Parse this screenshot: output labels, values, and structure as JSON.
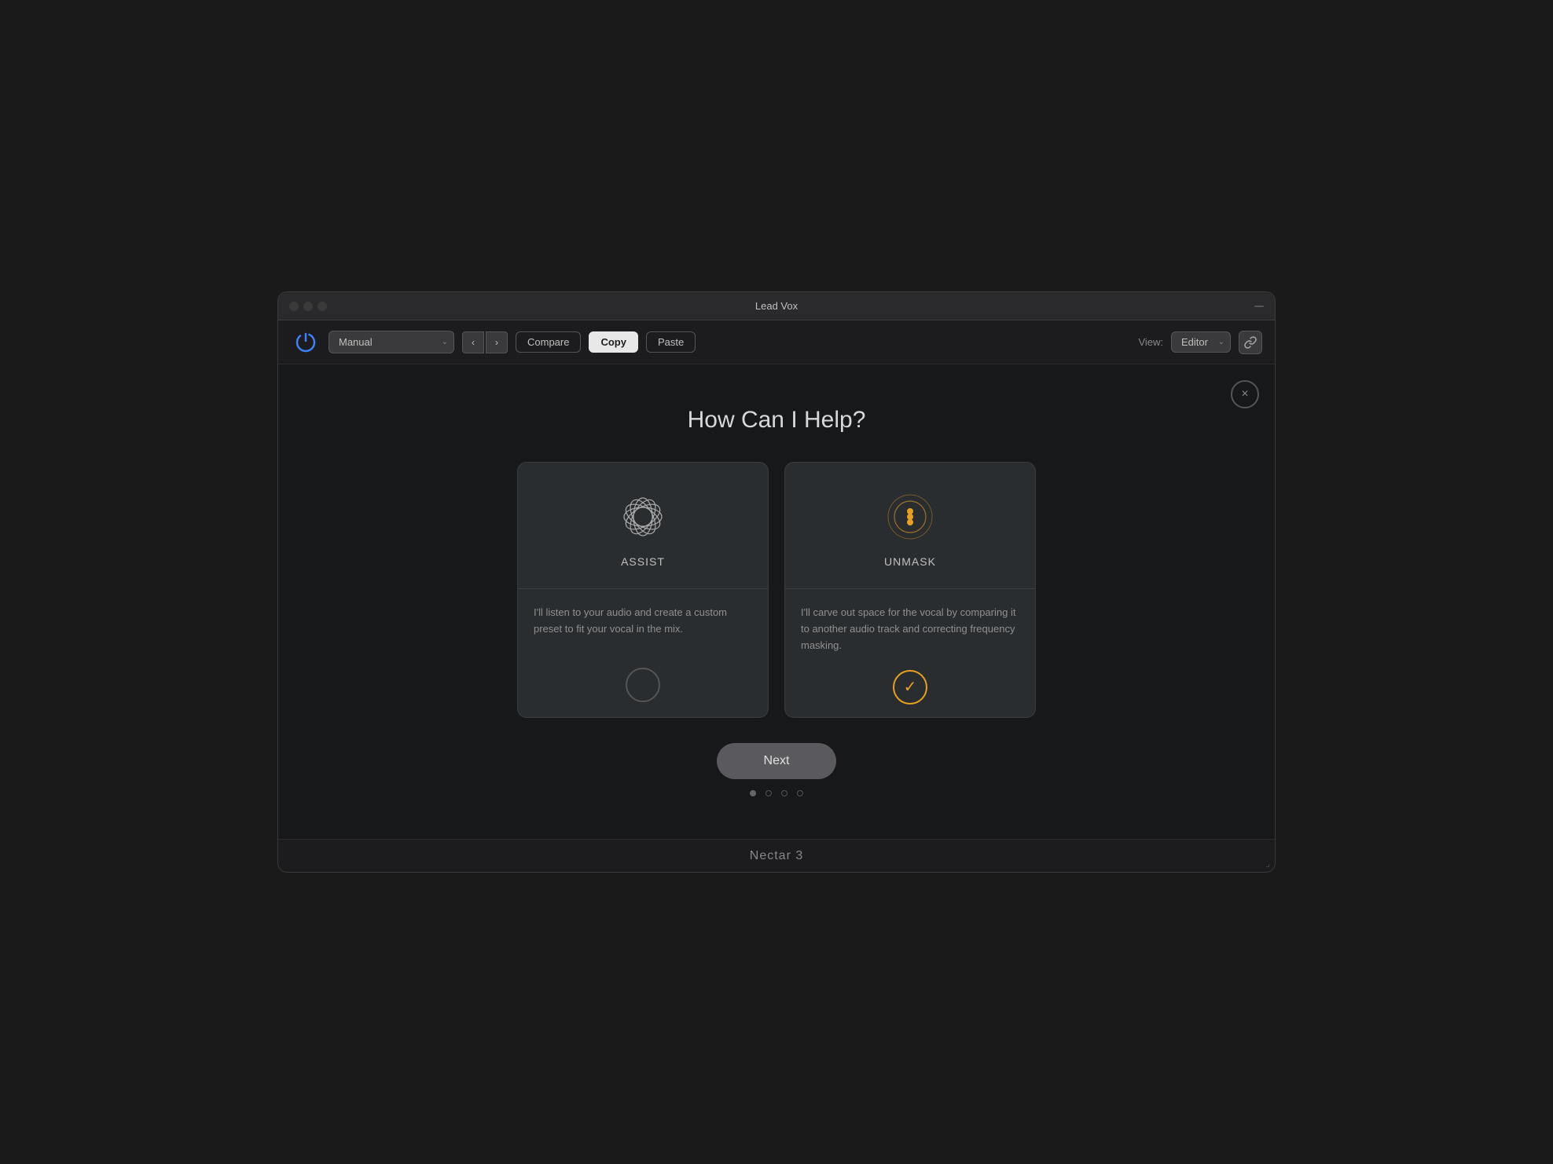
{
  "window": {
    "title": "Lead Vox"
  },
  "toolbar": {
    "preset_value": "Manual",
    "preset_placeholder": "Manual",
    "nav_back_label": "‹",
    "nav_forward_label": "›",
    "compare_label": "Compare",
    "copy_label": "Copy",
    "paste_label": "Paste",
    "view_label": "View:",
    "view_value": "Editor",
    "link_icon": "🔗"
  },
  "modal": {
    "title": "How Can I Help?",
    "close_label": "×",
    "cards": [
      {
        "id": "assist",
        "name": "ASSIST",
        "description": "I'll listen to your audio and create a custom preset to fit your vocal in the mix.",
        "selected": false
      },
      {
        "id": "unmask",
        "name": "UNMASK",
        "description": "I'll carve out space for the vocal by comparing it to another audio track and correcting frequency masking.",
        "selected": true
      }
    ],
    "next_label": "Next",
    "dots": [
      {
        "filled": true
      },
      {
        "filled": false
      },
      {
        "filled": false
      },
      {
        "filled": false
      }
    ]
  },
  "footer": {
    "title": "Nectar 3"
  }
}
